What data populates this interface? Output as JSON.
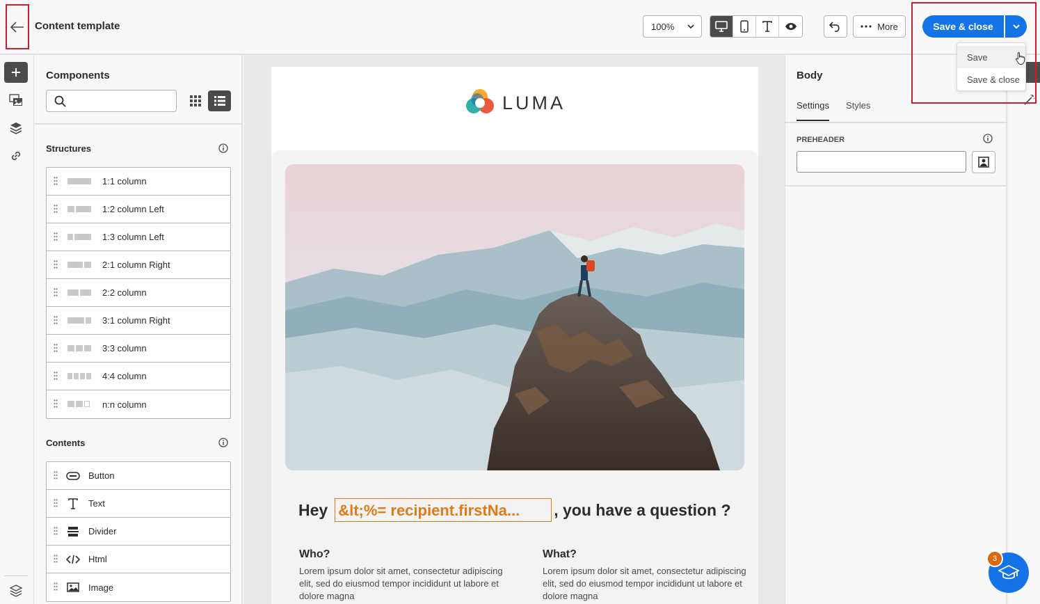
{
  "header": {
    "title": "Content template",
    "zoom": "100%",
    "more_label": "More",
    "save_close_label": "Save & close",
    "dropdown_menu": [
      "Save",
      "Save & close"
    ]
  },
  "components_panel": {
    "title": "Components",
    "search_placeholder": "",
    "structures_title": "Structures",
    "structures": [
      {
        "label": "1:1 column"
      },
      {
        "label": "1:2 column Left"
      },
      {
        "label": "1:3 column Left"
      },
      {
        "label": "2:1 column Right"
      },
      {
        "label": "2:2 column"
      },
      {
        "label": "3:1 column Right"
      },
      {
        "label": "3:3 column"
      },
      {
        "label": "4:4 column"
      },
      {
        "label": "n:n column"
      }
    ],
    "contents_title": "Contents",
    "contents": [
      {
        "label": "Button",
        "icon": "button-icon"
      },
      {
        "label": "Text",
        "icon": "text-icon"
      },
      {
        "label": "Divider",
        "icon": "divider-icon"
      },
      {
        "label": "Html",
        "icon": "code-icon"
      },
      {
        "label": "Image",
        "icon": "image-icon"
      }
    ]
  },
  "email": {
    "brand": "LUMA",
    "headline_before": "Hey",
    "personalization": "&lt;%= recipient.firstNa...",
    "headline_after": ", you have a question ?",
    "col_who_title": "Who?",
    "col_who_text": "Lorem ipsum dolor sit amet, consectetur adipiscing elit, sed do eiusmod tempor incididunt ut labore et dolore magna",
    "col_what_title": "What?",
    "col_what_text": "Lorem ipsum dolor sit amet, consectetur adipiscing elit, sed do eiusmod tempor incididunt ut labore et dolore magna"
  },
  "properties": {
    "title": "Body",
    "tabs": [
      "Settings",
      "Styles"
    ],
    "preheader_label": "PREHEADER",
    "preheader_value": ""
  },
  "help": {
    "badge_count": "3"
  },
  "colors": {
    "accent": "#1473e6",
    "highlight_border": "#c8202b",
    "personalization": "#e07b17"
  }
}
